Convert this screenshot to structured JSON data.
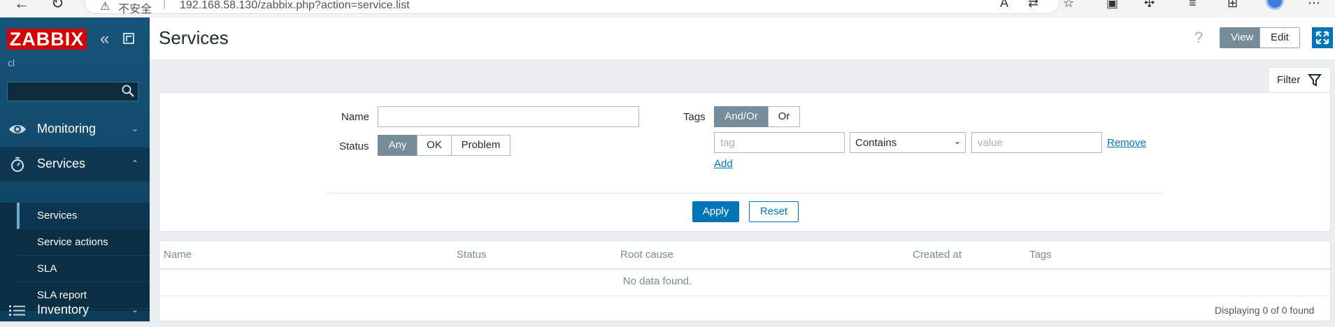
{
  "browser": {
    "security_warning": "不安全",
    "separator": "|",
    "url": "192.168.58.130/zabbix.php?action=service.list"
  },
  "sidebar": {
    "logo": "ZABBIX",
    "server_name": "cl",
    "search_placeholder": "",
    "menu": [
      {
        "label": "Monitoring",
        "arrow": "⌄"
      },
      {
        "label": "Services",
        "arrow": "⌃"
      },
      {
        "label": "Inventory",
        "arrow": "⌄"
      }
    ],
    "submenu": [
      {
        "label": "Services"
      },
      {
        "label": "Service actions"
      },
      {
        "label": "SLA"
      },
      {
        "label": "SLA report"
      }
    ]
  },
  "header": {
    "title": "Services",
    "help": "?",
    "view_label": "View",
    "edit_label": "Edit"
  },
  "filter": {
    "tab_label": "Filter",
    "name_label": "Name",
    "name_value": "",
    "status_label": "Status",
    "status_options": [
      "Any",
      "OK",
      "Problem"
    ],
    "status_selected": "Any",
    "tags_label": "Tags",
    "tags_mode_options": [
      "And/Or",
      "Or"
    ],
    "tags_mode_selected": "And/Or",
    "tag_placeholder": "tag",
    "operator_value": "Contains",
    "value_placeholder": "value",
    "remove_label": "Remove",
    "add_label": "Add",
    "apply_label": "Apply",
    "reset_label": "Reset"
  },
  "table": {
    "columns": [
      "Name",
      "Status",
      "Root cause",
      "Created at",
      "Tags"
    ],
    "empty_message": "No data found.",
    "footer": "Displaying 0 of 0 found"
  },
  "colors": {
    "sidebar_bg": "#0b4460",
    "logo_red": "#d40000",
    "accent_blue": "#0275b8",
    "segment_active": "#768d99"
  }
}
